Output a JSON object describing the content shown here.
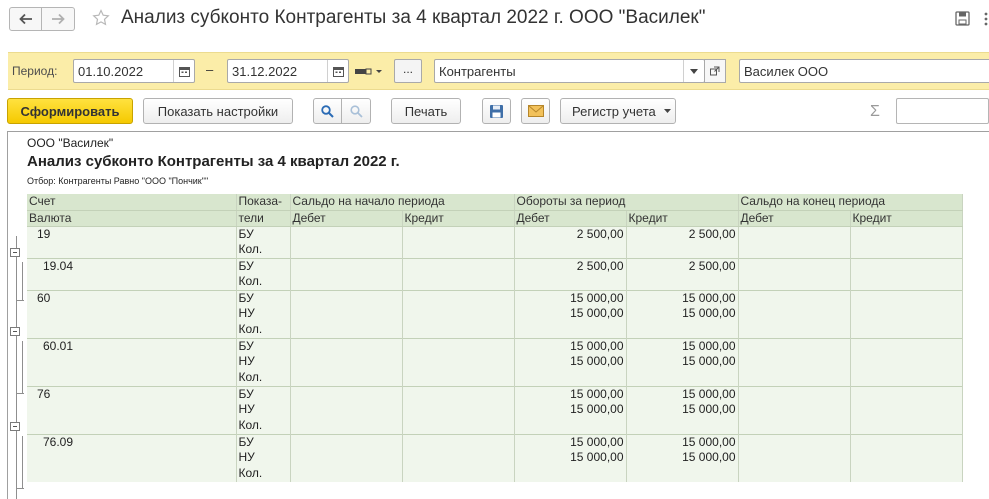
{
  "window": {
    "title": "Анализ субконто Контрагенты за 4 квартал 2022 г. ООО \"Василек\""
  },
  "filters": {
    "period_label": "Период:",
    "date_from": "01.10.2022",
    "dash": "–",
    "date_to": "31.12.2022",
    "ellipsis": "...",
    "subconto_type": "Контрагенты",
    "organization": "Василек ООО"
  },
  "toolbar": {
    "generate": "Сформировать",
    "show_settings": "Показать настройки",
    "print": "Печать",
    "register": "Регистр учета",
    "sigma": "Σ"
  },
  "report": {
    "org": "ООО \"Василек\"",
    "title": "Анализ субконто Контрагенты за 4 квартал 2022 г.",
    "filter": "Отбор: Контрагенты Равно \"ООО \"Пончик\"\"",
    "headers": {
      "account": "Счет",
      "currency": "Валюта",
      "indicator_1": "Показа-",
      "indicator_2": "тели",
      "opening": "Сальдо на начало периода",
      "turnover": "Обороты за период",
      "closing": "Сальдо на конец периода",
      "debit": "Дебет",
      "credit": "Кредит"
    },
    "rows": [
      {
        "account": "19",
        "indicator": "БУ",
        "turn_debit": "2 500,00",
        "turn_credit": "2 500,00"
      },
      {
        "account": "",
        "indicator": "Кол.",
        "turn_debit": "",
        "turn_credit": ""
      },
      {
        "account": "19.04",
        "indicator": "БУ",
        "turn_debit": "2 500,00",
        "turn_credit": "2 500,00"
      },
      {
        "account": "",
        "indicator": "Кол.",
        "turn_debit": "",
        "turn_credit": ""
      },
      {
        "account": "60",
        "indicator": "БУ",
        "turn_debit": "15 000,00",
        "turn_credit": "15 000,00"
      },
      {
        "account": "",
        "indicator": "НУ",
        "turn_debit": "15 000,00",
        "turn_credit": "15 000,00"
      },
      {
        "account": "",
        "indicator": "Кол.",
        "turn_debit": "",
        "turn_credit": ""
      },
      {
        "account": "60.01",
        "indicator": "БУ",
        "turn_debit": "15 000,00",
        "turn_credit": "15 000,00"
      },
      {
        "account": "",
        "indicator": "НУ",
        "turn_debit": "15 000,00",
        "turn_credit": "15 000,00"
      },
      {
        "account": "",
        "indicator": "Кол.",
        "turn_debit": "",
        "turn_credit": ""
      },
      {
        "account": "76",
        "indicator": "БУ",
        "turn_debit": "15 000,00",
        "turn_credit": "15 000,00"
      },
      {
        "account": "",
        "indicator": "НУ",
        "turn_debit": "15 000,00",
        "turn_credit": "15 000,00"
      },
      {
        "account": "",
        "indicator": "Кол.",
        "turn_debit": "",
        "turn_credit": ""
      },
      {
        "account": "76.09",
        "indicator": "БУ",
        "turn_debit": "15 000,00",
        "turn_credit": "15 000,00"
      },
      {
        "account": "",
        "indicator": "НУ",
        "turn_debit": "15 000,00",
        "turn_credit": "15 000,00"
      },
      {
        "account": "",
        "indicator": "Кол.",
        "turn_debit": "",
        "turn_credit": ""
      }
    ]
  }
}
